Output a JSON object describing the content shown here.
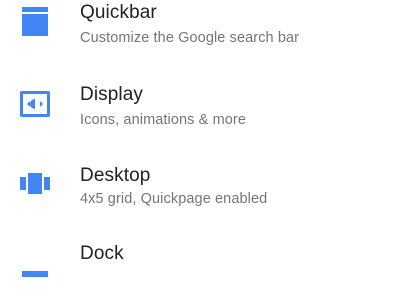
{
  "accent_color": "#4285f4",
  "settings": {
    "items": [
      {
        "title": "Quickbar",
        "subtitle": "Customize the Google search bar",
        "icon": "quickbar-icon"
      },
      {
        "title": "Display",
        "subtitle": "Icons, animations & more",
        "icon": "display-icon"
      },
      {
        "title": "Desktop",
        "subtitle": "4x5 grid, Quickpage enabled",
        "icon": "desktop-icon"
      },
      {
        "title": "Dock",
        "subtitle": "",
        "icon": "dock-icon"
      }
    ]
  }
}
